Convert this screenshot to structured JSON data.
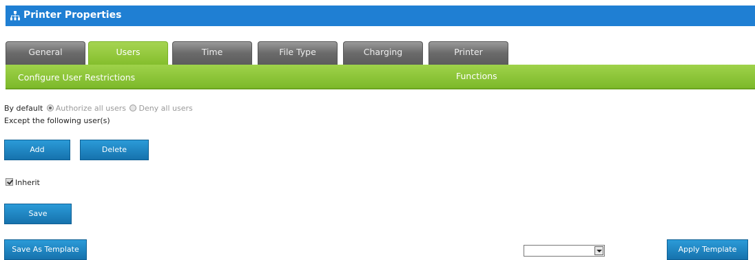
{
  "header": {
    "title": "Printer Properties",
    "icon": "network-printer-icon"
  },
  "tabs": [
    {
      "label": "General",
      "active": false
    },
    {
      "label": "Users",
      "active": true
    },
    {
      "label": "Time",
      "active": false
    },
    {
      "label": "File Type",
      "active": false
    },
    {
      "label": "Charging",
      "active": false
    },
    {
      "label": "Printer",
      "active": false
    }
  ],
  "section": {
    "title": "Configure User Restrictions",
    "functions_label": "Functions"
  },
  "restrictions": {
    "by_default_label": "By default",
    "authorize_all_label": "Authorize all users",
    "deny_all_label": "Deny all users",
    "selected": "authorize",
    "except_label": "Except the following user(s)"
  },
  "buttons": {
    "add": "Add",
    "delete": "Delete",
    "save": "Save",
    "save_as_template": "Save As Template",
    "apply_template": "Apply Template"
  },
  "inherit": {
    "label": "Inherit",
    "checked": true
  },
  "template_select": {
    "value": ""
  },
  "colors": {
    "header": "#1f7fd3",
    "green_bar": "#8cc63f",
    "button": "#1a84c4"
  }
}
